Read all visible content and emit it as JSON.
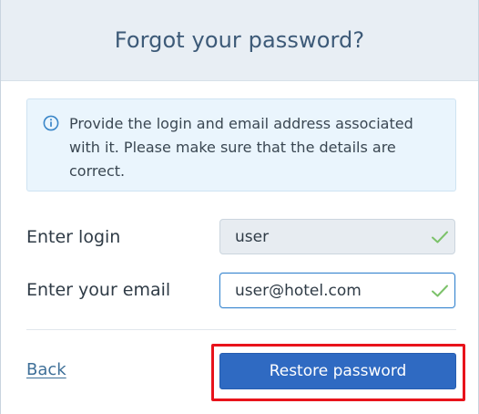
{
  "dialog": {
    "title": "Forgot your password?"
  },
  "info": {
    "icon": "info-circle-icon",
    "text": "Provide the login and email address associated with it. Please make sure that the details are correct."
  },
  "form": {
    "login": {
      "label": "Enter login",
      "value": "user",
      "valid": true
    },
    "email": {
      "label": "Enter your email",
      "value": "user@hotel.com",
      "valid": true
    }
  },
  "actions": {
    "back_label": "Back",
    "restore_label": "Restore password"
  },
  "colors": {
    "header_bg": "#e8eef4",
    "title": "#3d5a78",
    "info_bg": "#eaf5fd",
    "info_icon": "#3a86c8",
    "check": "#7cc26a",
    "primary_button": "#2f6ac2",
    "link": "#3e6f98",
    "highlight": "#e8131b"
  }
}
